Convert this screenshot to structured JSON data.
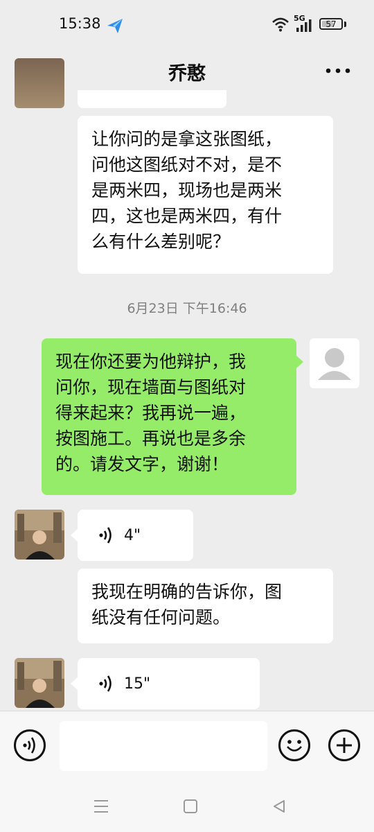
{
  "status_bar": {
    "time": "15:38",
    "network_label": "5G",
    "battery": "57",
    "icons": [
      "paper-plane-icon",
      "wifi-icon",
      "signal-icon",
      "battery-icon"
    ]
  },
  "header": {
    "title": "乔憨",
    "back_icon": "chevron-left-icon",
    "more_icon": "more-dots-icon"
  },
  "messages": [
    {
      "side": "left",
      "text": "让你问的是拿这张图纸，\n问他这图纸对不对，是不\n是两米四，现场也是两米\n四，这也是两米四，有什\n么有什么差别呢？"
    },
    {
      "timestamp": "6月23日 下午16:46"
    },
    {
      "side": "right",
      "text": "现在你还要为他辩护，我\n问你，现在墙面与图纸对\n得来起来？我再说一遍，\n按图施工。再说也是多余\n的。请发文字，谢谢！"
    },
    {
      "side": "left",
      "voice": "4\""
    },
    {
      "side": "left",
      "text": "我现在明确的告诉你，图\n纸没有任何问题。"
    },
    {
      "side": "left",
      "voice": "15\""
    }
  ],
  "input_bar": {
    "voice_icon": "voice-mode-icon",
    "emoji_icon": "emoji-icon",
    "plus_icon": "plus-icon",
    "input_value": ""
  },
  "nav_bar": {
    "icons": [
      "menu-icon",
      "home-square-icon",
      "back-triangle-icon"
    ]
  },
  "colors": {
    "background": "#ededed",
    "bubble_self": "#95ec69",
    "bubble_other": "#ffffff",
    "timestamp": "#7f7f7f"
  }
}
